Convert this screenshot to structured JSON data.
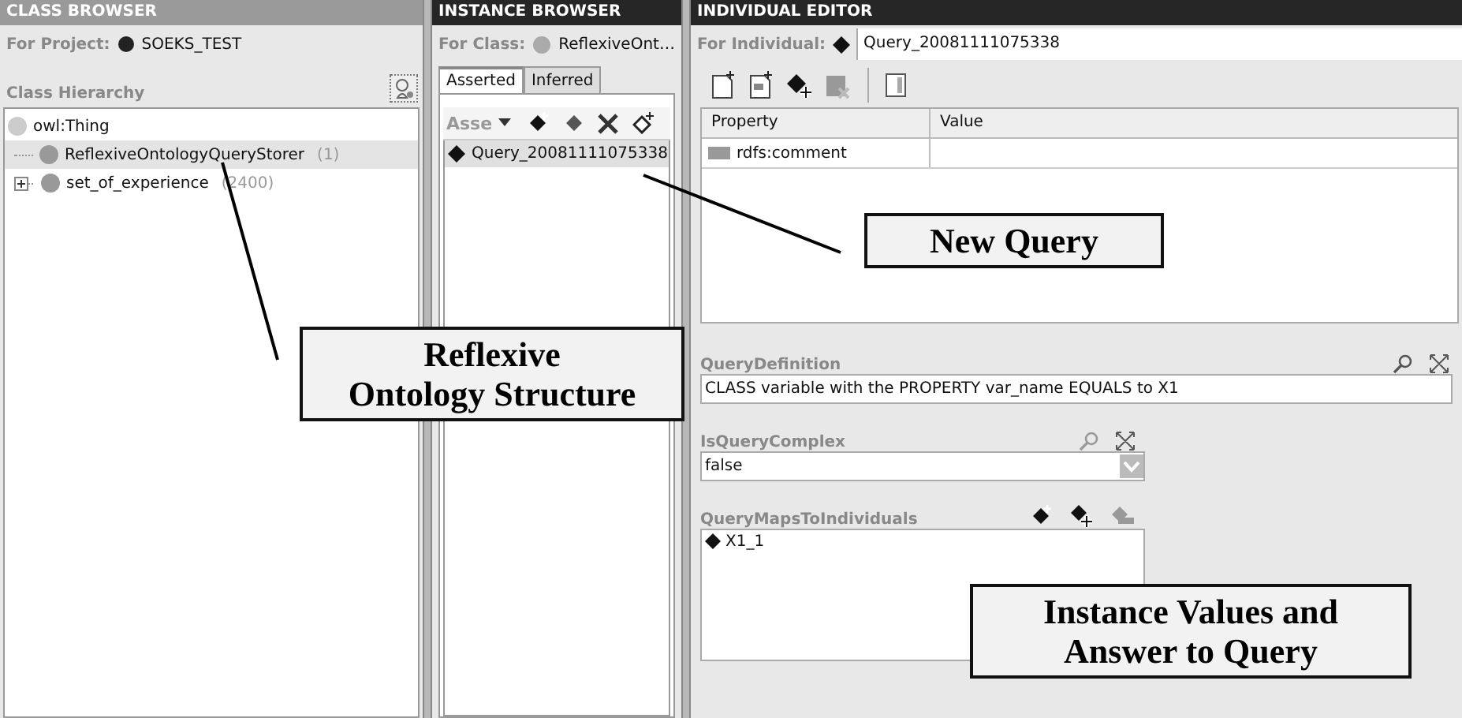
{
  "class_browser": {
    "title": "CLASS BROWSER",
    "project_label": "For Project:",
    "project": "SOEKS_TEST",
    "hierarchy_label": "Class Hierarchy",
    "tree": [
      {
        "label": "owl:Thing",
        "selected": false,
        "children": [
          {
            "label": "ReflexiveOntologyQueryStorer",
            "count": "(1)",
            "selected": true
          },
          {
            "label": "set_of_experience",
            "count": "(2400)",
            "selected": false,
            "expanded": false
          }
        ]
      }
    ]
  },
  "instance_browser": {
    "title": "INSTANCE BROWSER",
    "for_class_label": "For Class:",
    "for_class": "ReflexiveOnt…",
    "tabs": [
      {
        "label": "Asserted",
        "selected": true
      },
      {
        "label": "Inferred",
        "selected": false
      }
    ],
    "toolbar_label": "Asse",
    "instances": [
      {
        "label": "Query_20081111075338",
        "selected": true
      }
    ]
  },
  "individual_editor": {
    "title": "INDIVIDUAL EDITOR",
    "for_individual_label": "For Individual:",
    "for_individual": "Query_20081111075338",
    "table": {
      "columns": [
        "Property",
        "Value"
      ],
      "rows": [
        {
          "property": "rdfs:comment"
        }
      ]
    },
    "slots": [
      {
        "kind": "text",
        "label": "QueryDefinition",
        "value": "CLASS variable with the PROPERTY var_name EQUALS to X1"
      },
      {
        "kind": "dropdown",
        "label": "IsQueryComplex",
        "value": "false"
      },
      {
        "kind": "list",
        "label": "QueryMapsToIndividuals",
        "items": [
          "X1_1"
        ]
      }
    ]
  },
  "callouts": [
    {
      "lines": [
        "Reflexive",
        "Ontology Structure"
      ]
    },
    {
      "lines": [
        "New Query"
      ]
    },
    {
      "lines": [
        "Instance Values and",
        "Answer to Query"
      ]
    }
  ]
}
